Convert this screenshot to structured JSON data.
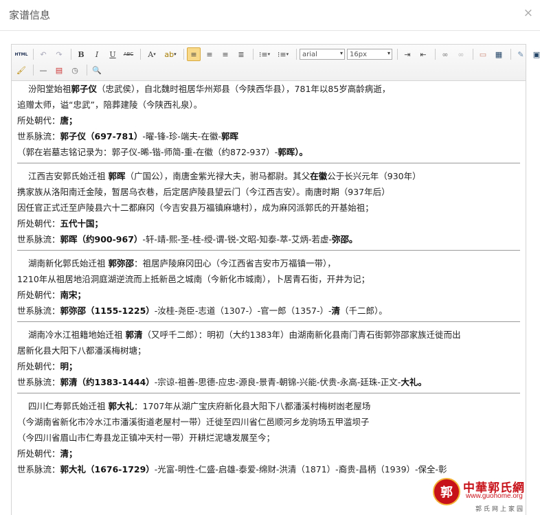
{
  "dialog": {
    "title": "家谱信息",
    "close": "×"
  },
  "toolbar": {
    "html": "HTML",
    "bold": "B",
    "italic": "I",
    "underline": "U",
    "strike": "ABC",
    "font_color": "A",
    "font_family": "arial",
    "font_size": "16px"
  },
  "entries": [
    {
      "lines": [
        [
          "汾阳堂始祖",
          "郭子仪",
          "（忠武侯），自北魏时祖居华州郑县（今陕西华县），781年以85岁高龄病逝，"
        ],
        [
          "追赠太师，谥“忠武”，陪葬建陵（今陕西礼泉）。"
        ]
      ],
      "dynasty_label": "所处朝代：",
      "dynasty": "唐；",
      "lineage_label": "世系脉流：",
      "lineage_bold": "郭子仪（697-781）",
      "lineage_rest": "-曜-锋-珍-端夫-在徽-",
      "lineage_end": "郭晖",
      "note": "（郭在岩墓志铭记录为：郭子仪-晞-锴-师简-重-在徽（约872-937）-",
      "note_end": "郭晖）。"
    },
    {
      "lines": [
        [
          "江西吉安郭氏始迁祖 ",
          "郭晖",
          "（广国公），南唐金紫光禄大夫，驸马都尉。其父",
          "在徽",
          "公于长兴元年（930年）"
        ],
        [
          "携家族从洛阳南迁金陵，暂居乌衣巷，后定居庐陵县望云门（今江西吉安）。南唐时期（937年后）"
        ],
        [
          "因任官正式迁至庐陵县六十二都麻冈（今吉安县万福镇麻塘村），成为麻冈派郭氏的开基始祖；"
        ]
      ],
      "dynasty_label": "所处朝代：",
      "dynasty": "五代十国；",
      "lineage_label": "世系脉流：",
      "lineage_bold": "郭晖（约900-967）",
      "lineage_rest": "-轩-靖-熙-圣-桂-绶-谓-锐-文昭-知泰-萃-艾炳-若虚-",
      "lineage_end": "弥邵。"
    },
    {
      "lines": [
        [
          "湖南新化郭氏始迁祖 ",
          "郭弥邵",
          "：祖居庐陵麻冈田心（今江西省吉安市万福镇一带），"
        ],
        [
          "1210年从祖居地沿洞庭湖逆流而上抵新邑之城南（今新化市城南），卜居青石街，开井为记；"
        ]
      ],
      "dynasty_label": "所处朝代：",
      "dynasty": "南宋；",
      "lineage_label": "世系脉流：",
      "lineage_bold": "郭弥邵（1155-1225）",
      "lineage_rest": "-汝桂-尧臣-志道（1307-）-官一郎（1357-）-",
      "lineage_end": "清",
      "lineage_tail": "（千二郎）。"
    },
    {
      "lines": [
        [
          "湖南冷水江祖籍地始迁祖 ",
          "郭清",
          "（又呼千二郎）：明初（大约1383年）由湖南新化县南门青石街郭弥邵家族迁徙而出"
        ],
        [
          "居新化县大阳下八都潘溪梅树塘；"
        ]
      ],
      "dynasty_label": "所处朝代：",
      "dynasty": "明；",
      "lineage_label": "世系脉流：",
      "lineage_bold": "郭清（约1383-1444）",
      "lineage_rest": "-宗谅-祖善-思德-应忠-源良-景青-朝锦-兴能-伏贵-永高-廷珠-正文-",
      "lineage_end": "大礼。"
    },
    {
      "lines": [
        [
          "四川仁寿郭氏始迁祖 ",
          "郭大礼",
          "：1707年从湖广宝庆府新化县大阳下八都潘溪村梅树凼老屋场"
        ],
        [
          "（今湖南省新化市冷水江市潘溪街道老屋村一带）迁徙至四川省仁邑顺河乡龙驹场五甲滥坝子"
        ],
        [
          "（今四川省眉山市仁寿县龙正镇冲天村一带）开耕烂泥塘发展至今；"
        ]
      ],
      "dynasty_label": "所处朝代：",
      "dynasty": "清；",
      "lineage_label": "世系脉流：",
      "lineage_bold": "郭大礼（1676-1729）",
      "lineage_rest": "-光富-明性-仁盛-启雄-泰爱-绵财-洪清（1871）-裔贵-昌柄（1939）-保全-彰"
    }
  ],
  "watermark": {
    "seal": "郭",
    "name": "中華郭氏網",
    "url": "www.guohome.org",
    "sub": "郭氏网上家园"
  }
}
